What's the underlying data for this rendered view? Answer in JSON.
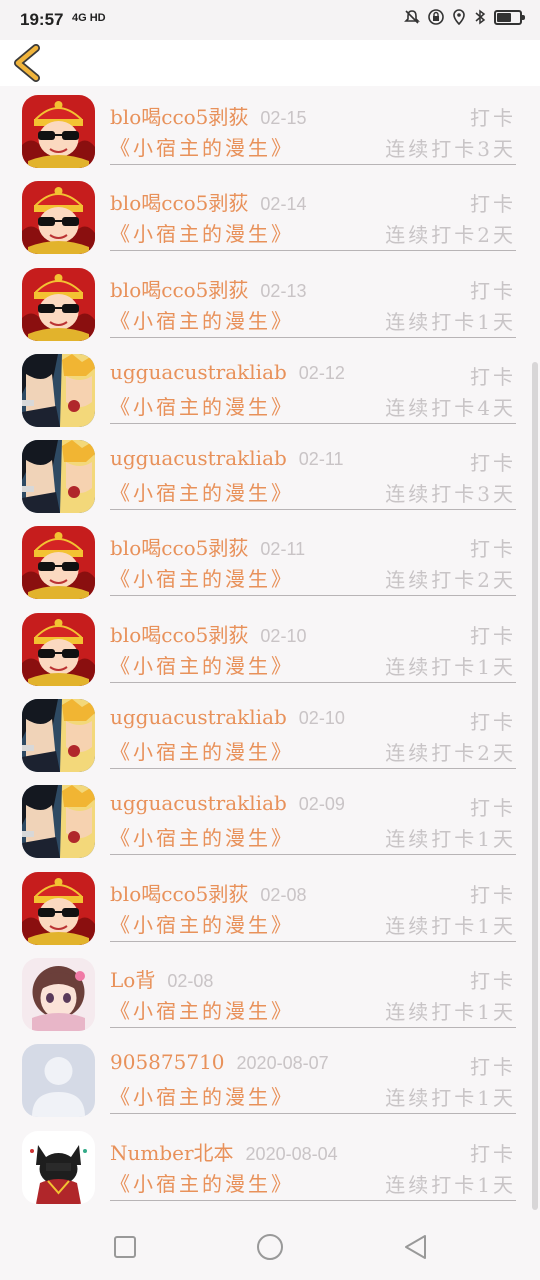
{
  "status_bar": {
    "time": "19:57",
    "network": "4G HD",
    "icons": [
      "mute-icon",
      "lock-icon",
      "location-icon",
      "bluetooth-icon",
      "battery-icon"
    ],
    "battery_level": 0.65
  },
  "header": {
    "back_icon": "chevron-left-icon",
    "accent_color": "#f0b43c"
  },
  "list": {
    "items": [
      {
        "user": "blo喝cco5剥荻",
        "date": "02-15",
        "book": "《小宿主的漫生》",
        "action": "打卡",
        "streak": "连续打卡3天",
        "avatar": "avatar-red"
      },
      {
        "user": "blo喝cco5剥荻",
        "date": "02-14",
        "book": "《小宿主的漫生》",
        "action": "打卡",
        "streak": "连续打卡2天",
        "avatar": "avatar-red"
      },
      {
        "user": "blo喝cco5剥荻",
        "date": "02-13",
        "book": "《小宿主的漫生》",
        "action": "打卡",
        "streak": "连续打卡1天",
        "avatar": "avatar-red"
      },
      {
        "user": "ugguacustrakliab",
        "date": "02-12",
        "book": "《小宿主的漫生》",
        "action": "打卡",
        "streak": "连续打卡4天",
        "avatar": "avatar-ninja"
      },
      {
        "user": "ugguacustrakliab",
        "date": "02-11",
        "book": "《小宿主的漫生》",
        "action": "打卡",
        "streak": "连续打卡3天",
        "avatar": "avatar-ninja"
      },
      {
        "user": "blo喝cco5剥荻",
        "date": "02-11",
        "book": "《小宿主的漫生》",
        "action": "打卡",
        "streak": "连续打卡2天",
        "avatar": "avatar-red"
      },
      {
        "user": "blo喝cco5剥荻",
        "date": "02-10",
        "book": "《小宿主的漫生》",
        "action": "打卡",
        "streak": "连续打卡1天",
        "avatar": "avatar-red"
      },
      {
        "user": "ugguacustrakliab",
        "date": "02-10",
        "book": "《小宿主的漫生》",
        "action": "打卡",
        "streak": "连续打卡2天",
        "avatar": "avatar-ninja"
      },
      {
        "user": "ugguacustrakliab",
        "date": "02-09",
        "book": "《小宿主的漫生》",
        "action": "打卡",
        "streak": "连续打卡1天",
        "avatar": "avatar-ninja"
      },
      {
        "user": "blo喝cco5剥荻",
        "date": "02-08",
        "book": "《小宿主的漫生》",
        "action": "打卡",
        "streak": "连续打卡1天",
        "avatar": "avatar-red"
      },
      {
        "user": "Lo背",
        "date": "02-08",
        "book": "《小宿主的漫生》",
        "action": "打卡",
        "streak": "连续打卡1天",
        "avatar": "avatar-girl"
      },
      {
        "user": "905875710",
        "date": "2020-08-07",
        "book": "《小宿主的漫生》",
        "action": "打卡",
        "streak": "连续打卡1天",
        "avatar": "avatar-default"
      },
      {
        "user": "Number北本",
        "date": "2020-08-04",
        "book": "《小宿主的漫生》",
        "action": "打卡",
        "streak": "连续打卡1天",
        "avatar": "avatar-cat"
      }
    ]
  },
  "nav_bar": {
    "buttons": [
      "recent-apps-icon",
      "home-icon",
      "back-triangle-icon"
    ]
  }
}
